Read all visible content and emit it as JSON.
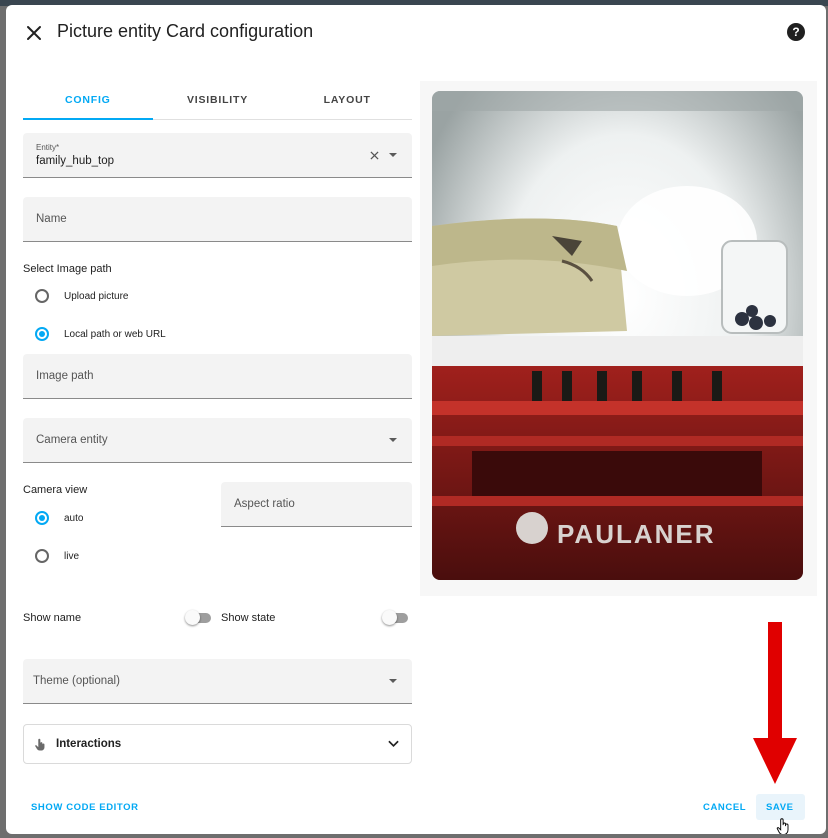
{
  "dialog": {
    "title": "Picture entity Card configuration",
    "help_glyph": "?",
    "close_icon": "close-icon"
  },
  "tabs": [
    {
      "label": "CONFIG",
      "active": true
    },
    {
      "label": "VISIBILITY",
      "active": false
    },
    {
      "label": "LAYOUT",
      "active": false
    }
  ],
  "entity": {
    "label": "Entity*",
    "value": "family_hub_top"
  },
  "name_field": {
    "label": "Name"
  },
  "image_path_section": {
    "title": "Select Image path",
    "options": [
      {
        "label": "Upload picture",
        "selected": false
      },
      {
        "label": "Local path or web URL",
        "selected": true
      }
    ]
  },
  "image_path_field": {
    "label": "Image path"
  },
  "camera_entity_field": {
    "label": "Camera entity"
  },
  "camera_view": {
    "title": "Camera view",
    "options": [
      {
        "label": "auto",
        "selected": true
      },
      {
        "label": "live",
        "selected": false
      }
    ]
  },
  "aspect_ratio_field": {
    "label": "Aspect ratio"
  },
  "toggles": {
    "show_name": {
      "label": "Show name",
      "on": false
    },
    "show_state": {
      "label": "Show state",
      "on": false
    }
  },
  "theme_field": {
    "label": "Theme (optional)"
  },
  "interactions": {
    "label": "Interactions"
  },
  "footer": {
    "code_editor_label": "SHOW CODE EDITOR",
    "cancel_label": "CANCEL",
    "save_label": "SAVE"
  },
  "preview": {
    "crate_brand": "PAULANER"
  },
  "colors": {
    "accent": "#03a9f4",
    "annotation_arrow": "#e00000"
  }
}
